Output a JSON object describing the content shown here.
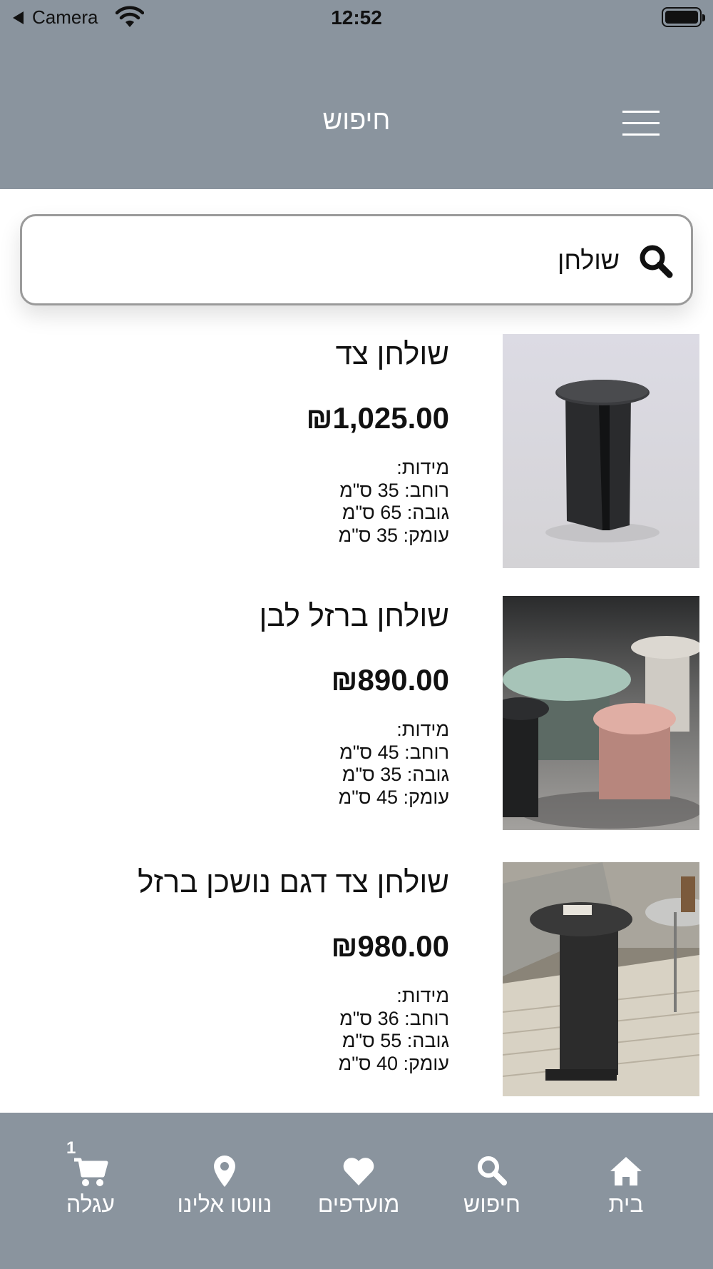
{
  "status_bar": {
    "back_label": "Camera",
    "time": "12:52"
  },
  "header": {
    "title": "חיפוש"
  },
  "search": {
    "value": "שולחן",
    "placeholder": ""
  },
  "products": [
    {
      "name": "שולחן צד",
      "price": "₪1,025.00",
      "dims_title": "מידות:",
      "width": "רוחב: 35 ס\"מ",
      "height": "גובה: 65 ס\"מ",
      "depth": "עומק: 35 ס\"מ"
    },
    {
      "name": "שולחן ברזל לבן",
      "price": "₪890.00",
      "dims_title": "מידות:",
      "width": "רוחב: 45 ס\"מ",
      "height": "גובה: 35 ס\"מ",
      "depth": "עומק: 45 ס\"מ"
    },
    {
      "name": "שולחן צד דגם נושכן ברזל",
      "price": "₪980.00",
      "dims_title": "מידות:",
      "width": "רוחב: 36 ס\"מ",
      "height": "גובה: 55 ס\"מ",
      "depth": "עומק: 40 ס\"מ"
    }
  ],
  "bottom_nav": {
    "cart_count": "1",
    "items": [
      {
        "label": "עגלה",
        "icon": "cart-icon"
      },
      {
        "label": "נווטו אלינו",
        "icon": "location-pin-icon"
      },
      {
        "label": "מועדפים",
        "icon": "heart-icon"
      },
      {
        "label": "חיפוש",
        "icon": "search-icon"
      },
      {
        "label": "בית",
        "icon": "home-icon"
      }
    ]
  },
  "colors": {
    "bar_background": "#8a949e",
    "bar_text": "#ffffff"
  }
}
